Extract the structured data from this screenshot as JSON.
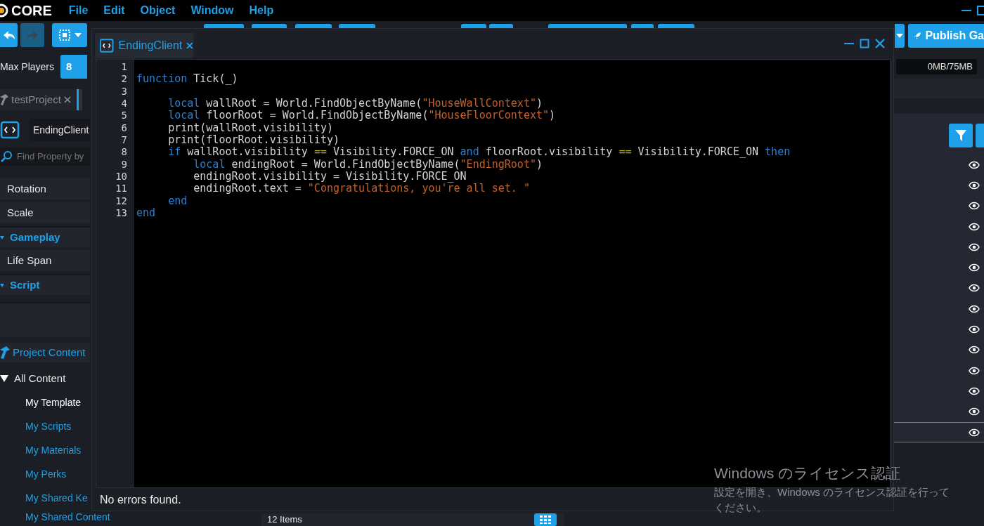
{
  "app": {
    "logo": "CORE",
    "menu": [
      "File",
      "Edit",
      "Object",
      "Window",
      "Help"
    ]
  },
  "toolbar": {
    "publish_button": "Publish Ga"
  },
  "left_panel": {
    "max_players_label": "Max Players",
    "max_players_value": "8",
    "tabs": [
      {
        "label": "testProject",
        "selected": false
      }
    ],
    "object_name": "EndingClient",
    "search": {
      "placeholder": "Find Property by"
    },
    "properties": [
      {
        "kind": "row",
        "label": "Rotation"
      },
      {
        "kind": "row",
        "label": "Scale"
      },
      {
        "kind": "section",
        "label": "Gameplay"
      },
      {
        "kind": "row",
        "label": "Life Span"
      },
      {
        "kind": "section",
        "label": "Script"
      }
    ],
    "project_content": {
      "title": "Project Content",
      "root": {
        "label": "All Content",
        "expanded": true,
        "children": [
          {
            "label": "My Template",
            "color": "#ffffff"
          },
          {
            "label": "My Scripts",
            "color": "#1ea1e8"
          },
          {
            "label": "My Materials",
            "color": "#1ea1e8"
          },
          {
            "label": "My Perks",
            "color": "#1ea1e8"
          },
          {
            "label": "My Shared Ke",
            "color": "#1ea1e8"
          },
          {
            "label": "My Shared Content",
            "color": "#1ea1e8"
          }
        ]
      }
    }
  },
  "right_panel": {
    "memory": "0MB/75MB",
    "rows": [
      {
        "selected": false
      },
      {
        "selected": false
      },
      {
        "selected": false
      },
      {
        "selected": false
      },
      {
        "selected": false
      },
      {
        "selected": false
      },
      {
        "selected": false
      },
      {
        "selected": false
      },
      {
        "selected": false
      },
      {
        "selected": false
      },
      {
        "selected": false
      },
      {
        "selected": false
      },
      {
        "selected": false
      },
      {
        "selected": true
      }
    ]
  },
  "bottom_bar": {
    "item_count": "12 Items"
  },
  "script_window": {
    "tab": "EndingClient",
    "status": "No errors found.",
    "lines": [
      {
        "number": "1"
      },
      {
        "number": "2",
        "tokens": [
          {
            "kind": "keyword",
            "text": "function"
          },
          {
            "kind": "plain",
            "text": " Tick(_)"
          }
        ]
      },
      {
        "number": "3"
      },
      {
        "number": "4",
        "tokens": [
          {
            "kind": "keyword",
            "text": "     local"
          },
          {
            "kind": "plain",
            "text": " wallRoot = World.FindObjectByName("
          },
          {
            "kind": "string",
            "text": "\"HouseWallContext\""
          },
          {
            "kind": "plain",
            "text": ")"
          }
        ]
      },
      {
        "number": "5",
        "tokens": [
          {
            "kind": "keyword",
            "text": "     local"
          },
          {
            "kind": "plain",
            "text": " floorRoot = World.FindObjectByName("
          },
          {
            "kind": "string",
            "text": "\"HouseFloorContext\""
          },
          {
            "kind": "plain",
            "text": ")"
          }
        ]
      },
      {
        "number": "6",
        "tokens": [
          {
            "kind": "plain",
            "text": "     print(wallRoot.visibility)"
          }
        ]
      },
      {
        "number": "7",
        "tokens": [
          {
            "kind": "plain",
            "text": "     print(floorRoot.visibility)"
          }
        ]
      },
      {
        "number": "8",
        "tokens": [
          {
            "kind": "keyword",
            "text": "     if"
          },
          {
            "kind": "plain",
            "text": " wallRoot.visibility "
          },
          {
            "kind": "operator",
            "text": "=="
          },
          {
            "kind": "plain",
            "text": " Visibility.FORCE_ON "
          },
          {
            "kind": "keyword",
            "text": "and"
          },
          {
            "kind": "plain",
            "text": " floorRoot.visibility "
          },
          {
            "kind": "operator",
            "text": "=="
          },
          {
            "kind": "plain",
            "text": " Visibility.FORCE_ON "
          },
          {
            "kind": "keyword",
            "text": "then"
          }
        ]
      },
      {
        "number": "9",
        "tokens": [
          {
            "kind": "keyword",
            "text": "         local"
          },
          {
            "kind": "plain",
            "text": " endingRoot = World.FindObjectByName("
          },
          {
            "kind": "string",
            "text": "\"EndingRoot\""
          },
          {
            "kind": "plain",
            "text": ")"
          }
        ]
      },
      {
        "number": "10",
        "tokens": [
          {
            "kind": "plain",
            "text": "         endingRoot.visibility = Visibility.FORCE_ON"
          }
        ]
      },
      {
        "number": "11",
        "tokens": [
          {
            "kind": "plain",
            "text": "         endingRoot.text = "
          },
          {
            "kind": "string",
            "text": "\"Congratulations, you're all set. \""
          }
        ]
      },
      {
        "number": "12",
        "tokens": [
          {
            "kind": "keyword",
            "text": "     end"
          }
        ]
      },
      {
        "number": "13",
        "tokens": [
          {
            "kind": "keyword",
            "text": "end"
          }
        ]
      }
    ]
  },
  "windows_notice": {
    "title": "Windows のライセンス認証",
    "message": "設定を開き、Windows のライセンス認証を行ってください。"
  }
}
